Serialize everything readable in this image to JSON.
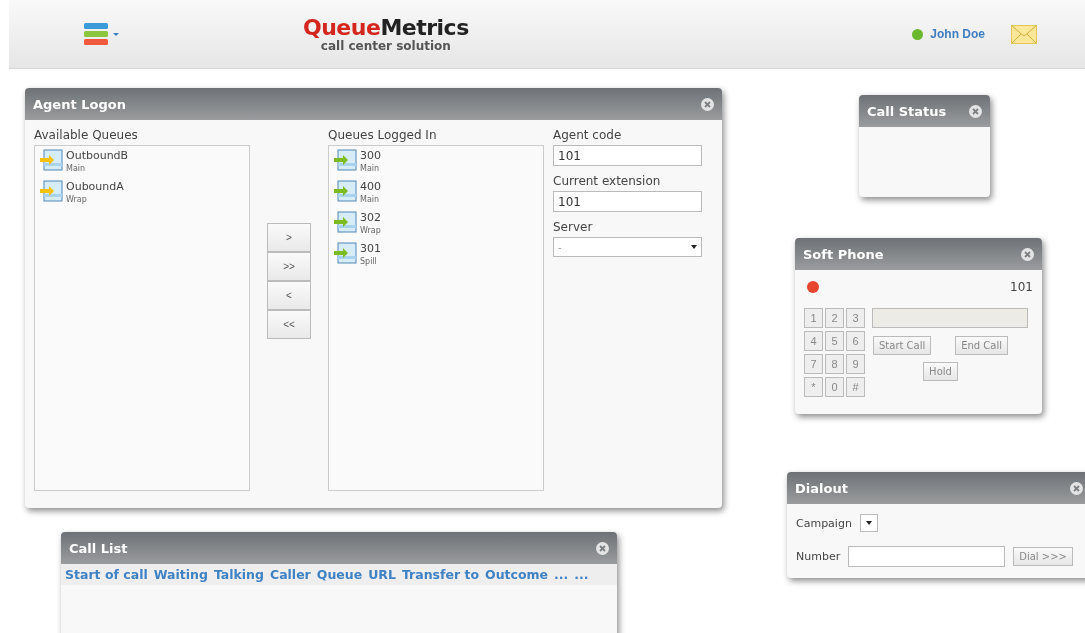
{
  "header": {
    "logo": {
      "part_1": "Queue",
      "part_2": "Metrics",
      "tagline": "call center solution"
    },
    "user": {
      "name": "John Doe",
      "online": true
    }
  },
  "agent_logon": {
    "title": "Agent Logon",
    "available_label": "Available Queues",
    "available": [
      {
        "name": "OutboundB",
        "sub": "Main"
      },
      {
        "name": "OuboundA",
        "sub": "Wrap"
      }
    ],
    "logged_label": "Queues Logged In",
    "logged": [
      {
        "name": "300",
        "sub": "Main"
      },
      {
        "name": "400",
        "sub": "Main"
      },
      {
        "name": "302",
        "sub": "Wrap"
      },
      {
        "name": "301",
        "sub": "Spill"
      }
    ],
    "move_buttons": [
      ">",
      ">>",
      "<",
      "<<"
    ],
    "fields": [
      {
        "label": "Agent code",
        "value": "101",
        "kind": "text"
      },
      {
        "label": "Current extension",
        "value": "101",
        "kind": "text"
      },
      {
        "label": "Server",
        "value": "-",
        "kind": "select"
      }
    ]
  },
  "call_status": {
    "title": "Call Status"
  },
  "soft_phone": {
    "title": "Soft Phone",
    "registered": false,
    "extension": "101",
    "keys": [
      "1",
      "2",
      "3",
      "4",
      "5",
      "6",
      "7",
      "8",
      "9",
      "*",
      "0",
      "#"
    ],
    "buttons": [
      "Start Call",
      "End Call",
      "Hold"
    ]
  },
  "dialout": {
    "title": "Dialout",
    "campaign_label": "Campaign",
    "number_label": "Number",
    "dial_button": "Dial >>>"
  },
  "call_list": {
    "title": "Call List",
    "columns": [
      "Start of call",
      "Waiting",
      "Talking",
      "Caller",
      "Queue",
      "URL",
      "Transfer to",
      "Outcome",
      "...",
      "..."
    ]
  }
}
